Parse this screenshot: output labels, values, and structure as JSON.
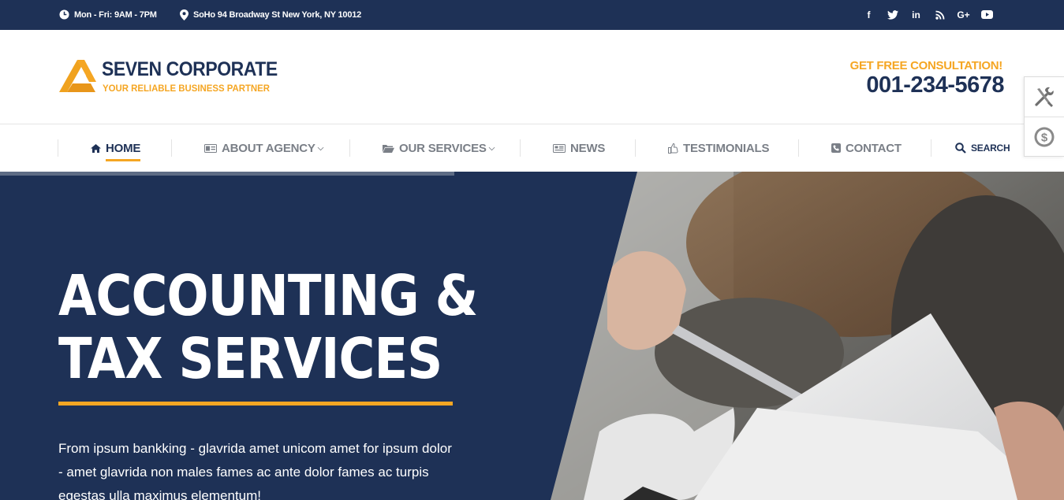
{
  "topbar": {
    "hours": "Mon - Fri: 9AM - 7PM",
    "address": "SoHo 94 Broadway St New York, NY 10012",
    "social_icons": [
      "facebook-icon",
      "twitter-icon",
      "linkedin-icon",
      "rss-icon",
      "google-plus-icon",
      "youtube-icon"
    ],
    "social_glyphs": [
      "f",
      "t",
      "in",
      "rss",
      "G+",
      "yt"
    ]
  },
  "brand": {
    "name": "SEVEN CORPORATE",
    "tagline": "YOUR RELIABLE BUSINESS PARTNER"
  },
  "consultation": {
    "label": "GET FREE CONSULTATION!",
    "phone": "001-234-5678"
  },
  "nav": {
    "items": [
      {
        "label": "HOME",
        "icon": "home-icon",
        "active": true
      },
      {
        "label": "ABOUT AGENCY",
        "icon": "id-card-icon",
        "dropdown": true
      },
      {
        "label": "OUR SERVICES",
        "icon": "folder-icon",
        "dropdown": true
      },
      {
        "label": "NEWS",
        "icon": "newspaper-icon"
      },
      {
        "label": "TESTIMONIALS",
        "icon": "thumbs-up-icon"
      },
      {
        "label": "CONTACT",
        "icon": "phone-icon"
      }
    ],
    "search_label": "SEARCH"
  },
  "side_tools": [
    "tools-icon",
    "dollar-icon"
  ],
  "hero": {
    "title_line1": "ACCOUNTING &",
    "title_line2": "TAX SERVICES",
    "text": "From ipsum bankking - glavrida amet unicom amet for ipsum dolor - amet glavrida non males fames ac ante dolor fames ac turpis egestas ulla maximus elementum!"
  },
  "colors": {
    "navy": "#1e3156",
    "accent": "#f5a623",
    "nav_text": "#7a7f87"
  }
}
